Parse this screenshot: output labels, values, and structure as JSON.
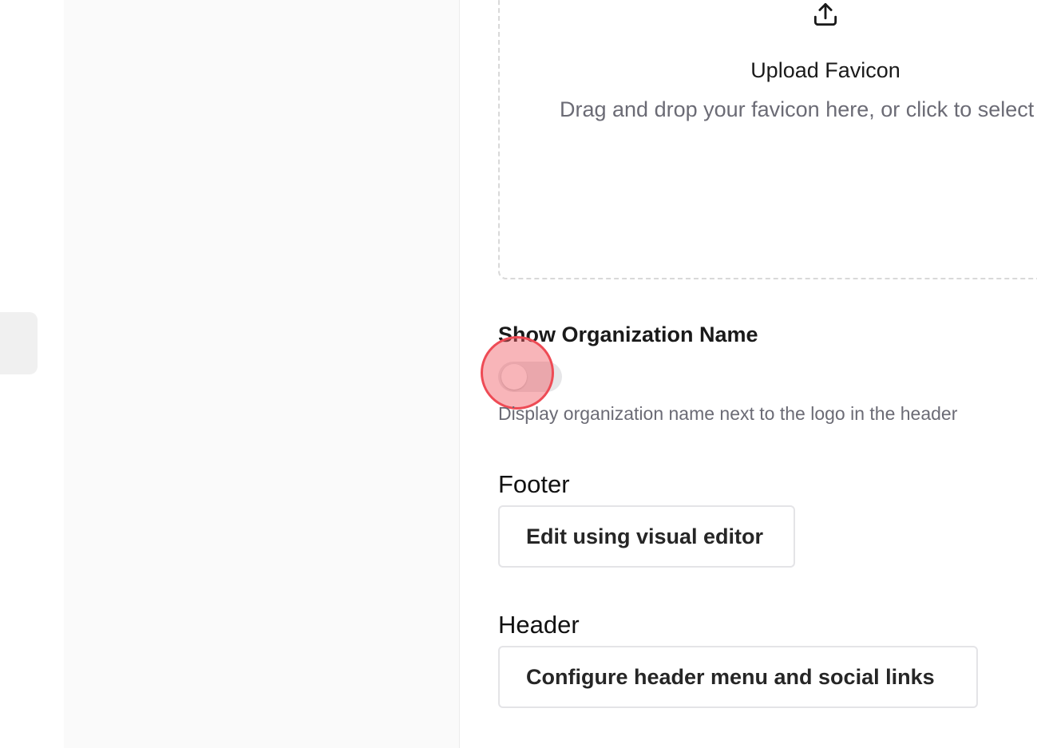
{
  "upload": {
    "icon": "upload-icon",
    "title": "Upload Favicon",
    "description": "Drag and drop your favicon here, or click to select"
  },
  "show_org_name": {
    "label": "Show Organization Name",
    "enabled": false,
    "help": "Display organization name next to the logo in the header"
  },
  "footer": {
    "title": "Footer",
    "button_label": "Edit using visual editor"
  },
  "header": {
    "title": "Header",
    "button_label": "Configure header menu and social links"
  },
  "colors": {
    "click_marker": "#ee4b55",
    "dropzone_border": "#d9d9d9",
    "muted_text": "#6b6b75"
  }
}
